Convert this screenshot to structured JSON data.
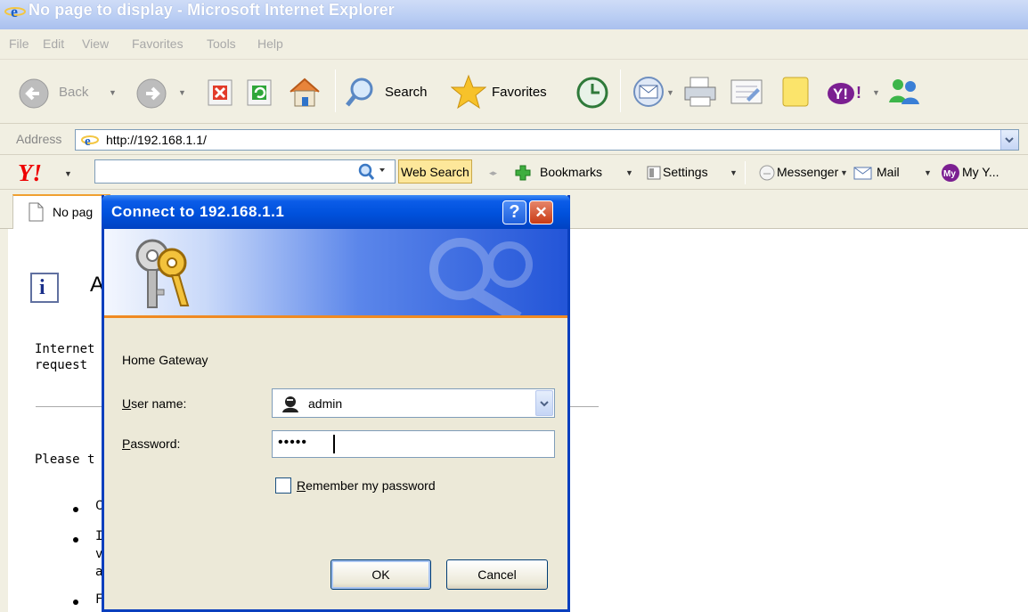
{
  "window": {
    "title": "No page to display - Microsoft Internet Explorer"
  },
  "menu": [
    "File",
    "Edit",
    "View",
    "Favorites",
    "Tools",
    "Help"
  ],
  "toolbar": {
    "back_label": "Back",
    "search_label": "Search",
    "favorites_label": "Favorites"
  },
  "address": {
    "label": "Address",
    "url": "http://192.168.1.1/"
  },
  "yahoo": {
    "web_search_label": "Web Search",
    "bookmarks_label": "Bookmarks",
    "settings_label": "Settings",
    "messenger_label": "Messenger",
    "mail_label": "Mail",
    "my_label": "My Y..."
  },
  "tab": {
    "label": "No pag"
  },
  "page": {
    "heading": "A",
    "line1": "Internet",
    "line2": "request",
    "please": "Please t",
    "b1": "C",
    "b2a": "I",
    "b2b": "v",
    "b2c": "a",
    "b3": "F"
  },
  "dialog": {
    "title": "Connect to 192.168.1.1",
    "realm": "Home Gateway",
    "username_label_key": "U",
    "username_label_rest": "ser name:",
    "username_value": "admin",
    "password_label_key": "P",
    "password_label_rest": "assword:",
    "password_value": "•••••",
    "remember_key": "R",
    "remember_rest": "emember my password",
    "remember_checked": false,
    "ok_label": "OK",
    "cancel_label": "Cancel",
    "help_glyph": "?",
    "close_glyph": "✕"
  }
}
